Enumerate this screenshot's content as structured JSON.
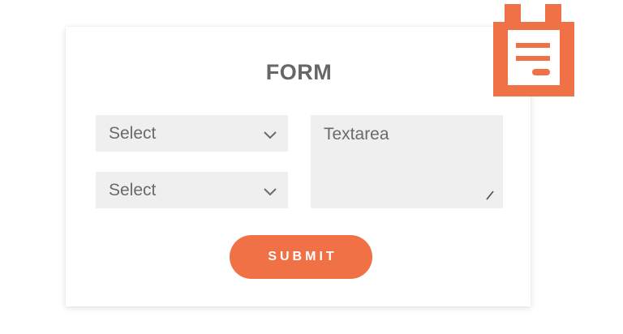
{
  "form": {
    "title": "FORM",
    "select_1": {
      "value": "Select"
    },
    "select_2": {
      "value": "Select"
    },
    "textarea": {
      "placeholder": "Textarea"
    },
    "submit_label": "SUBMIT"
  },
  "colors": {
    "accent": "#f07145",
    "field_bg": "#efefef",
    "text": "#666666"
  },
  "icons": {
    "form_badge": "clipboard-form-icon",
    "select_chevron": "chevron-down-icon",
    "resize": "resize-grip-icon"
  }
}
